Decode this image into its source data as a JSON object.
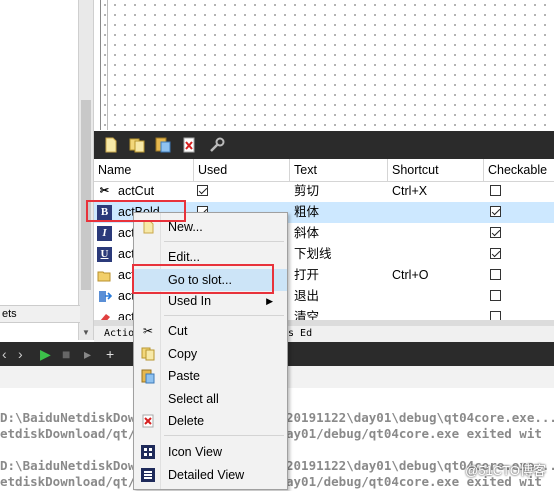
{
  "sidebar": {
    "properties_fragment": "ets"
  },
  "action_editor": {
    "columns": [
      "Name",
      "Used",
      "Text",
      "Shortcut",
      "Checkable"
    ],
    "rows": [
      {
        "name": "actCut",
        "icon": "scissors-icon",
        "used": true,
        "text": "剪切",
        "shortcut": "Ctrl+X",
        "checkable": false,
        "selected": false
      },
      {
        "name": "actBold",
        "icon": "bold-icon",
        "used": true,
        "text": "粗体",
        "shortcut": "",
        "checkable": true,
        "selected": true
      },
      {
        "name": "act",
        "icon": "italic-icon",
        "used": false,
        "text": "斜体",
        "shortcut": "",
        "checkable": true,
        "selected": false
      },
      {
        "name": "act",
        "icon": "underline-icon",
        "used": false,
        "text": "下划线",
        "shortcut": "",
        "checkable": true,
        "selected": false
      },
      {
        "name": "act",
        "icon": "folder-open-icon",
        "used": false,
        "text": "打开",
        "shortcut": "Ctrl+O",
        "checkable": false,
        "selected": false
      },
      {
        "name": "act",
        "icon": "exit-icon",
        "used": false,
        "text": "退出",
        "shortcut": "",
        "checkable": false,
        "selected": false
      },
      {
        "name": "act",
        "icon": "eraser-icon",
        "used": false,
        "text": "清空",
        "shortcut": "",
        "checkable": false,
        "selected": false
      }
    ],
    "tabs": [
      "Actio",
      "ts Ed"
    ]
  },
  "context_menu": {
    "items": [
      {
        "label": "New...",
        "icon": "new-file-icon",
        "highlighted": false
      },
      {
        "label": "Edit...",
        "icon": "",
        "highlighted": false
      },
      {
        "label": "Go to slot...",
        "icon": "",
        "highlighted": true
      },
      {
        "label": "Used In",
        "icon": "",
        "highlighted": false,
        "submenu": true
      },
      {
        "label": "Cut",
        "icon": "scissors-icon",
        "highlighted": false
      },
      {
        "label": "Copy",
        "icon": "copy-icon",
        "highlighted": false
      },
      {
        "label": "Paste",
        "icon": "paste-icon",
        "highlighted": false
      },
      {
        "label": "Select all",
        "icon": "",
        "highlighted": false
      },
      {
        "label": "Delete",
        "icon": "delete-icon",
        "highlighted": false
      },
      {
        "label": "Icon View",
        "icon": "icon-view-icon",
        "highlighted": false
      },
      {
        "label": "Detailed View",
        "icon": "detailed-view-icon",
        "highlighted": false
      }
    ]
  },
  "output": {
    "lines": [
      "D:\\BaiduNetdiskDow",
      "etdiskDownload/qt/",
      "D:\\BaiduNetdiskDow",
      "etdiskDownload/qt/"
    ],
    "lines_right": [
      "20191122\\day01\\debug\\qt04core.exe...",
      "ay01/debug/qt04core.exe exited wit",
      "20191122\\day01\\debug\\qt04core.exe...",
      "ay01/debug/qt04core.exe exited wit"
    ]
  },
  "watermark": "@51CTO博客",
  "colors": {
    "highlight_box": "#e8323b",
    "selection": "#cde8ff",
    "toolbar": "#2b2b2b"
  }
}
